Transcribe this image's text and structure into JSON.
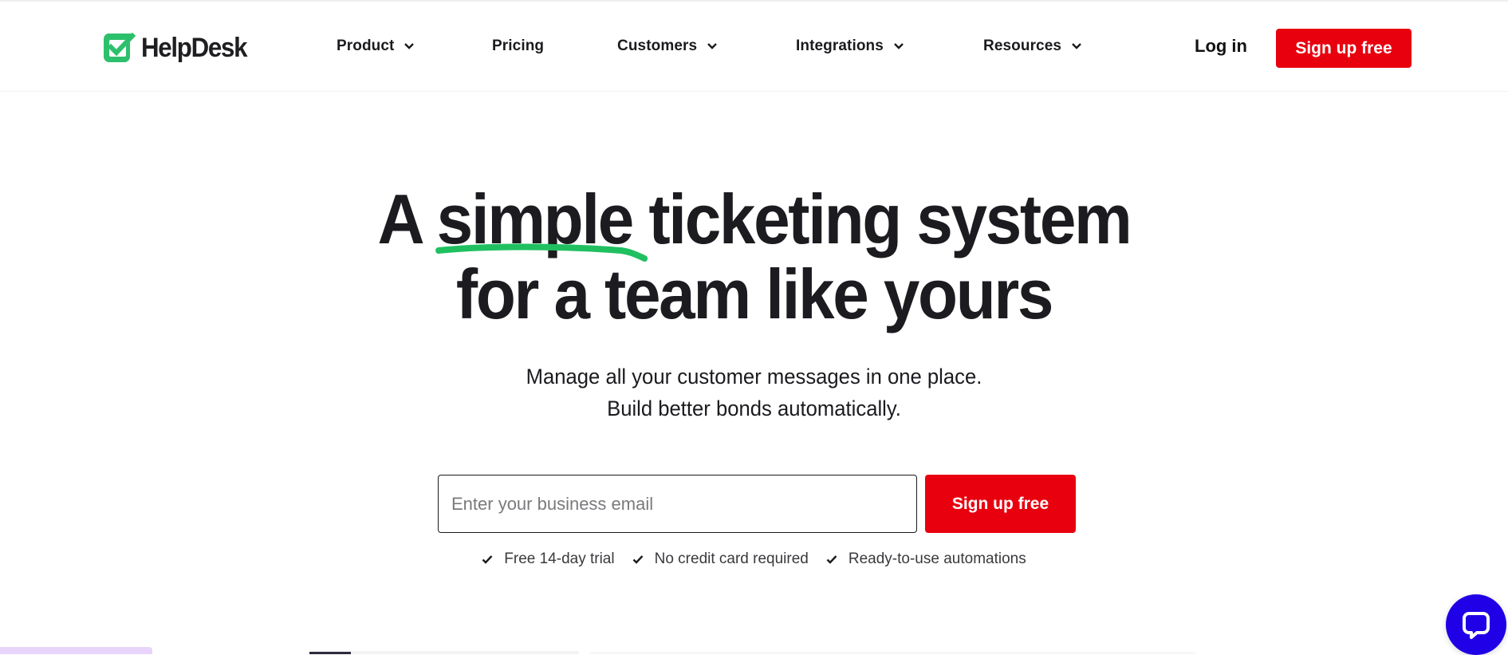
{
  "brand": {
    "name": "HelpDesk",
    "logo_icon": "checkmark-box-icon",
    "primary_color": "#e8000f",
    "accent_green": "#20c060",
    "chat_color": "#2000e6"
  },
  "nav": {
    "items": [
      {
        "label": "Product",
        "has_dropdown": true
      },
      {
        "label": "Pricing",
        "has_dropdown": false
      },
      {
        "label": "Customers",
        "has_dropdown": true
      },
      {
        "label": "Integrations",
        "has_dropdown": true
      },
      {
        "label": "Resources",
        "has_dropdown": true
      }
    ],
    "login_label": "Log in",
    "signup_label": "Sign up free"
  },
  "hero": {
    "title_pre": "A ",
    "title_highlight": "simple",
    "title_post": " ticketing system",
    "title_line2": "for a team like yours",
    "subtitle_line1": "Manage all your customer messages in one place.",
    "subtitle_line2": "Build better bonds automatically."
  },
  "signup_form": {
    "email_placeholder": "Enter your business email",
    "email_value": "",
    "submit_label": "Sign up free"
  },
  "features": [
    {
      "icon": "check-icon",
      "label": "Free 14-day trial"
    },
    {
      "icon": "check-icon",
      "label": "No credit card required"
    },
    {
      "icon": "check-icon",
      "label": "Ready-to-use automations"
    }
  ],
  "chat_widget": {
    "icon": "chat-bubble-icon"
  }
}
